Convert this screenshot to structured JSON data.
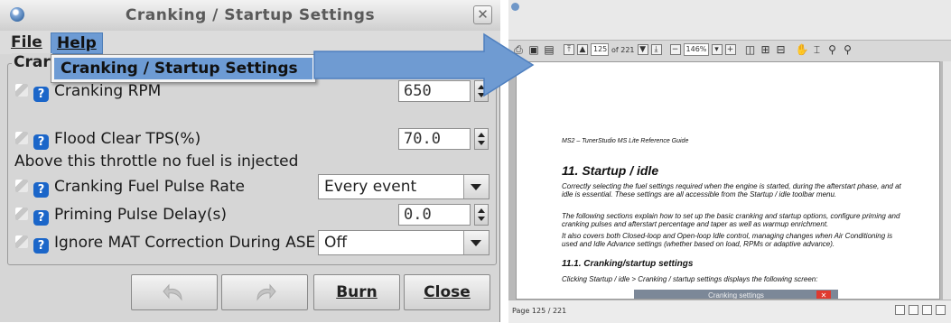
{
  "dialog": {
    "title": "Cranking / Startup Settings",
    "close_glyph": "✕",
    "menu": {
      "file": "File",
      "help": "Help"
    },
    "help_dropdown": {
      "item": "Cranking / Startup Settings"
    },
    "group_title": "Crar",
    "rows": [
      {
        "label": "Cranking RPM",
        "value": "650",
        "control": "spinner"
      },
      {
        "label": "Flood Clear TPS(%)",
        "value": "70.0",
        "control": "spinner"
      },
      {
        "label": "Above this throttle no fuel is injected",
        "control": "note"
      },
      {
        "label": "Cranking Fuel Pulse Rate",
        "value": "Every event",
        "control": "combo"
      },
      {
        "label": "Priming Pulse Delay(s)",
        "value": "0.0",
        "control": "spinner"
      },
      {
        "label": "Ignore MAT Correction During ASE",
        "value": "Off",
        "control": "combo"
      }
    ],
    "buttons": {
      "undo_icon": "undo-icon",
      "redo_icon": "redo-icon",
      "burn": "Burn",
      "close": "Close"
    },
    "colors": {
      "help_highlight": "#6d9bd4",
      "help_icon": "#1b66c9",
      "arrow": "#6f9bd2"
    }
  },
  "pdf_viewer": {
    "toolbar": {
      "page_input": "125",
      "page_total": "of 221",
      "zoom": "146%",
      "icons": [
        "print-icon",
        "save-icon",
        "properties-icon",
        "first-page-icon",
        "prev-page-icon",
        "next-page-icon",
        "last-page-icon",
        "zoom-out-icon",
        "zoom-dropdown-icon",
        "zoom-in-icon",
        "fit-width-icon",
        "fit-page-icon",
        "single-page-icon",
        "hand-tool-icon",
        "text-select-icon",
        "zoom-tool-icon",
        "zoom-dynamic-icon"
      ]
    },
    "page": {
      "header": "MS2 – TunerStudio MS Lite Reference Guide",
      "heading": "11. Startup / idle",
      "paragraphs": [
        "Correctly selecting the fuel settings required when the engine is started, during the afterstart phase, and at idle is essential. These settings are all accessible from the Startup / idle toolbar menu.",
        "The following sections explain how to set up the basic cranking and startup options, configure priming and cranking pulses and afterstart percentage and taper as well as warmup enrichment.",
        "It also covers both Closed-loop and Open-loop Idle control, managing changes when Air Conditioning is used and Idle Advance settings (whether based on load, RPMs or adaptive advance)."
      ],
      "subheading": "11.1. Cranking/startup settings",
      "subtext": "Clicking Startup / idle > Cranking / startup settings displays the following screen:",
      "thumbnail_title": "Cranking settings",
      "thumbnail_close": "✕"
    },
    "status": {
      "page_info": "Page 125 / 221"
    }
  }
}
